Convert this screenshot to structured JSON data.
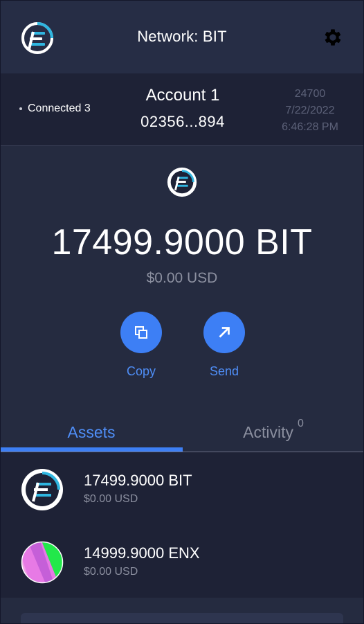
{
  "header": {
    "network_title": "Network: BIT",
    "logo_icon": "bit-logo-icon",
    "settings_icon": "gear-icon"
  },
  "account": {
    "connected_label": "Connected 3",
    "name": "Account 1",
    "address_short": "02356...894",
    "block_height": "24700",
    "date": "7/22/2022",
    "time": "6:46:28 PM"
  },
  "wallet": {
    "balance": "17499.9000 BIT",
    "balance_usd": "$0.00 USD",
    "actions": [
      {
        "label": "Copy",
        "icon": "copy-icon"
      },
      {
        "label": "Send",
        "icon": "arrow-up-right-icon"
      }
    ]
  },
  "tabs": {
    "assets": "Assets",
    "activity": "Activity",
    "activity_count": "0",
    "active": "assets"
  },
  "assets": [
    {
      "amount": "17499.9000 BIT",
      "usd": "$0.00 USD",
      "icon": "bit-token-icon"
    },
    {
      "amount": "14999.9000 ENX",
      "usd": "$0.00 USD",
      "icon": "enx-token-icon"
    }
  ],
  "colors": {
    "accent": "#3d7ff5",
    "background": "#252b40",
    "panel": "#1e2236",
    "muted_text": "#8b8f9f"
  }
}
